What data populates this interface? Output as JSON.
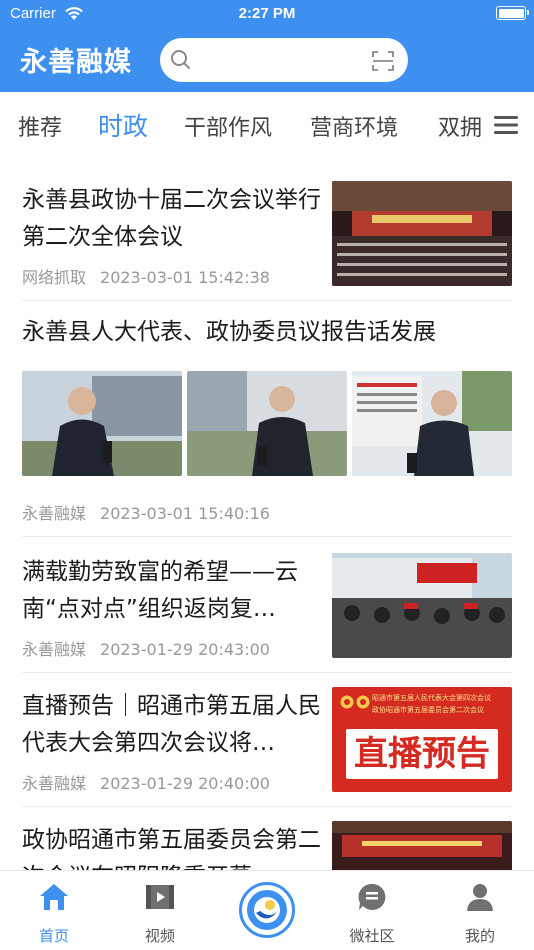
{
  "status_bar": {
    "carrier": "Carrier",
    "time": "2:27 PM"
  },
  "header": {
    "app_title": "永善融媒",
    "search_placeholder": "",
    "accent_color": "#3d8ff0"
  },
  "channels": {
    "items": [
      "推荐",
      "时政",
      "干部作风",
      "营商环境",
      "双拥"
    ],
    "active_index": 1,
    "menu_icon": "hamburger-menu-icon"
  },
  "news": [
    {
      "title": "永善县政协十届二次会议举行第二次全体会议",
      "source": "网络抓取",
      "time": "2023-03-01 15:42:38",
      "layout": "right-thumb"
    },
    {
      "title": "永善县人大代表、政协委员议报告话发展",
      "source": "永善融媒",
      "time": "2023-03-01 15:40:16",
      "layout": "three-images"
    },
    {
      "title": "满载勤劳致富的希望——云南“点对点”组织返岗复…",
      "source": "永善融媒",
      "time": "2023-01-29 20:43:00",
      "layout": "right-thumb"
    },
    {
      "title": "直播预告｜昭通市第五届人民代表大会第四次会议将…",
      "source": "永善融媒",
      "time": "2023-01-29 20:40:00",
      "layout": "right-thumb",
      "thumb_text": {
        "line1": "昭通市第五届人民代表大会第四次会议",
        "line2": "政协昭通市第五届委员会第二次会议",
        "big": "直播预告"
      }
    },
    {
      "title": "政协昭通市第五届委员会第二次会议在昭阳隆重开幕",
      "source": "",
      "time": "",
      "layout": "right-thumb"
    }
  ],
  "tabbar": {
    "items": [
      {
        "label": "首页",
        "icon": "home-icon"
      },
      {
        "label": "视频",
        "icon": "video-icon"
      },
      {
        "label": "",
        "icon": "live-center-icon"
      },
      {
        "label": "微社区",
        "icon": "community-chat-icon"
      },
      {
        "label": "我的",
        "icon": "profile-icon"
      }
    ],
    "active_index": 0
  }
}
